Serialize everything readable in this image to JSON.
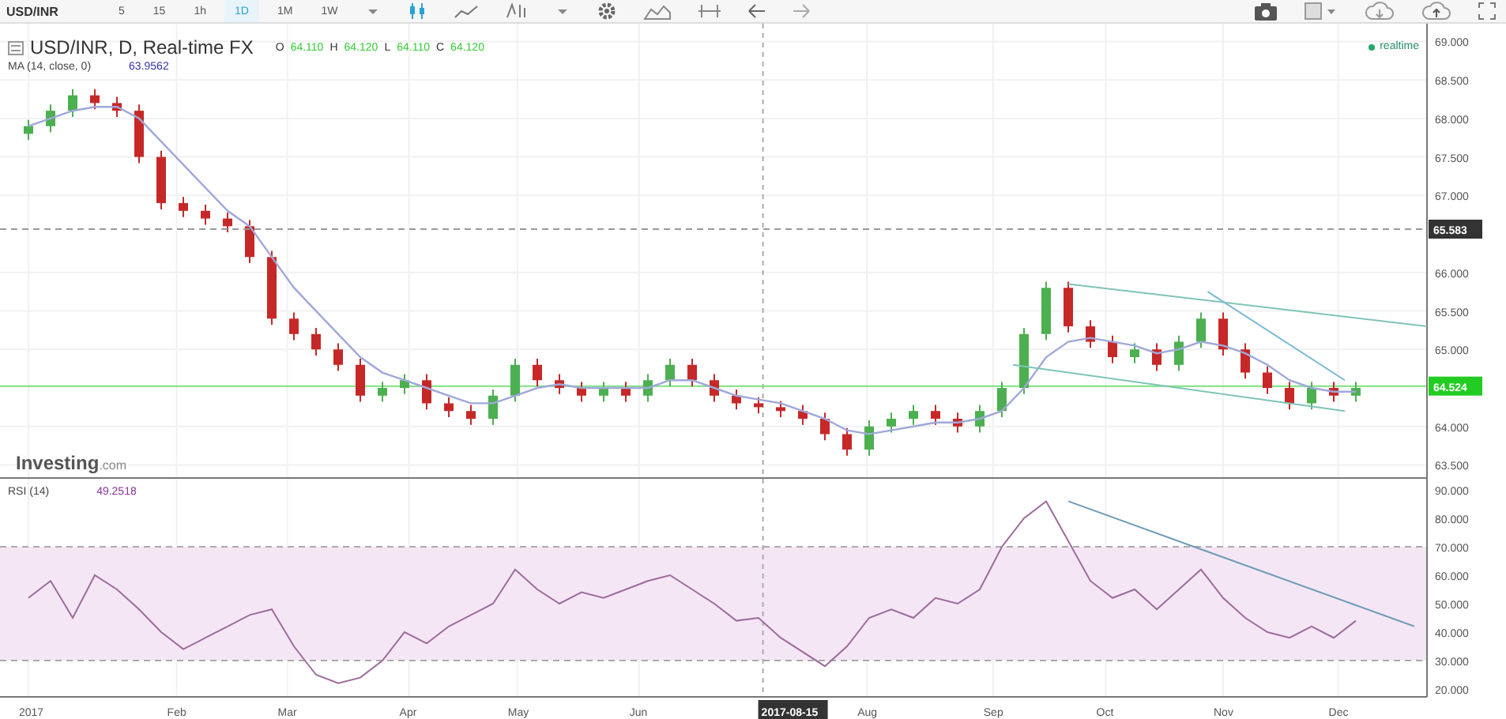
{
  "toolbar": {
    "intervals": [
      {
        "label": "5",
        "selected": false
      },
      {
        "label": "15",
        "selected": false
      },
      {
        "label": "1h",
        "selected": false
      },
      {
        "label": "1D",
        "selected": true
      },
      {
        "label": "1M",
        "selected": false
      },
      {
        "label": "1W",
        "selected": false
      }
    ]
  },
  "legend": {
    "title": "USD/INR, D, Real-time FX",
    "ohlc": [
      {
        "key": "O",
        "value": "64.110"
      },
      {
        "key": "H",
        "value": "64.120"
      },
      {
        "key": "L",
        "value": "64.110"
      },
      {
        "key": "C",
        "value": "64.120"
      }
    ],
    "ma_value": "63.9562",
    "status": "realtime"
  },
  "logo": {
    "name": "Investing",
    "suffix": ".com"
  },
  "price_chart": {
    "symbol": "USD/INR",
    "chart_data": {
      "type": "candlestick",
      "grid": true,
      "categories": [
        null,
        null,
        null,
        null,
        null,
        null,
        null,
        null,
        null,
        null,
        null,
        null,
        null,
        null,
        null,
        null,
        null,
        null,
        null,
        null,
        null,
        null,
        null,
        null,
        null,
        null,
        null,
        null,
        null,
        null,
        null,
        null,
        null,
        null,
        null,
        null,
        null,
        null,
        null,
        null,
        null,
        null,
        null,
        null,
        null,
        null,
        null,
        null,
        null,
        null,
        null,
        null,
        null,
        null,
        null,
        null,
        null,
        null,
        null,
        null,
        null
      ],
      "ylim": [
        63.32,
        69.23
      ],
      "yticks": [
        {
          "value": 69,
          "label": "69.000"
        },
        {
          "value": 68.5,
          "label": "68.500"
        },
        {
          "value": 68,
          "label": "68.000"
        },
        {
          "value": 67.5,
          "label": "67.500"
        },
        {
          "value": 67,
          "label": "67.000"
        },
        {
          "value": 66,
          "label": "66.000"
        },
        {
          "value": 65.5,
          "label": "65.500"
        },
        {
          "value": 65,
          "label": "65.000"
        },
        {
          "value": 64,
          "label": "64.000"
        },
        {
          "value": 63.5,
          "label": "63.500"
        }
      ],
      "ohlc": [
        [
          67.8,
          67.98,
          67.72,
          67.9
        ],
        [
          67.9,
          68.18,
          67.82,
          68.1
        ],
        [
          68.1,
          68.38,
          68.02,
          68.3
        ],
        [
          68.3,
          68.38,
          68.12,
          68.2
        ],
        [
          68.2,
          68.28,
          68.02,
          68.1
        ],
        [
          68.1,
          68.18,
          67.42,
          67.5
        ],
        [
          67.5,
          67.58,
          66.82,
          66.9
        ],
        [
          66.9,
          66.98,
          66.72,
          66.8
        ],
        [
          66.8,
          66.88,
          66.62,
          66.7
        ],
        [
          66.7,
          66.78,
          66.52,
          66.6
        ],
        [
          66.6,
          66.68,
          66.12,
          66.2
        ],
        [
          66.2,
          66.28,
          65.32,
          65.4
        ],
        [
          65.4,
          65.48,
          65.12,
          65.2
        ],
        [
          65.2,
          65.28,
          64.92,
          65.0
        ],
        [
          65.0,
          65.08,
          64.72,
          64.8
        ],
        [
          64.8,
          64.88,
          64.32,
          64.4
        ],
        [
          64.4,
          64.58,
          64.32,
          64.5
        ],
        [
          64.5,
          64.68,
          64.42,
          64.6
        ],
        [
          64.6,
          64.68,
          64.22,
          64.3
        ],
        [
          64.3,
          64.38,
          64.12,
          64.2
        ],
        [
          64.2,
          64.28,
          64.02,
          64.1
        ],
        [
          64.1,
          64.48,
          64.02,
          64.4
        ],
        [
          64.4,
          64.88,
          64.32,
          64.8
        ],
        [
          64.8,
          64.88,
          64.52,
          64.6
        ],
        [
          64.6,
          64.68,
          64.42,
          64.5
        ],
        [
          64.5,
          64.58,
          64.32,
          64.4
        ],
        [
          64.4,
          64.58,
          64.32,
          64.5
        ],
        [
          64.5,
          64.58,
          64.32,
          64.4
        ],
        [
          64.4,
          64.68,
          64.32,
          64.6
        ],
        [
          64.6,
          64.88,
          64.52,
          64.8
        ],
        [
          64.8,
          64.88,
          64.52,
          64.6
        ],
        [
          64.6,
          64.68,
          64.32,
          64.4
        ],
        [
          64.4,
          64.48,
          64.22,
          64.3
        ],
        [
          64.3,
          64.38,
          64.17,
          64.25
        ],
        [
          64.25,
          64.33,
          64.12,
          64.2
        ],
        [
          64.2,
          64.28,
          64.02,
          64.1
        ],
        [
          64.1,
          64.18,
          63.82,
          63.9
        ],
        [
          63.9,
          63.98,
          63.62,
          63.7
        ],
        [
          63.7,
          64.08,
          63.62,
          64.0
        ],
        [
          64.0,
          64.18,
          63.92,
          64.1
        ],
        [
          64.1,
          64.28,
          64.02,
          64.2
        ],
        [
          64.2,
          64.28,
          64.02,
          64.1
        ],
        [
          64.1,
          64.18,
          63.92,
          64.0
        ],
        [
          64.0,
          64.28,
          63.92,
          64.2
        ],
        [
          64.2,
          64.58,
          64.12,
          64.5
        ],
        [
          64.5,
          65.28,
          64.42,
          65.2
        ],
        [
          65.2,
          65.88,
          65.12,
          65.8
        ],
        [
          65.8,
          65.88,
          65.22,
          65.3
        ],
        [
          65.3,
          65.38,
          65.02,
          65.1
        ],
        [
          65.1,
          65.18,
          64.82,
          64.9
        ],
        [
          64.9,
          65.08,
          64.82,
          65.0
        ],
        [
          65.0,
          65.08,
          64.72,
          64.8
        ],
        [
          64.8,
          65.18,
          64.72,
          65.1
        ],
        [
          65.1,
          65.48,
          65.02,
          65.4
        ],
        [
          65.4,
          65.48,
          64.92,
          65.0
        ],
        [
          65.0,
          65.08,
          64.62,
          64.7
        ],
        [
          64.7,
          64.78,
          64.42,
          64.5
        ],
        [
          64.5,
          64.58,
          64.22,
          64.3
        ],
        [
          64.3,
          64.58,
          64.22,
          64.5
        ],
        [
          64.5,
          64.58,
          64.32,
          64.4
        ],
        [
          64.4,
          64.58,
          64.32,
          64.5
        ]
      ],
      "ref_lines": [
        {
          "axis": "y",
          "value": 64.524,
          "label": "64.524"
        }
      ],
      "series": [
        {
          "name": "MA (14, close, 0)",
          "type": "line",
          "color": "#9fa8da",
          "values": [
            67.9,
            68.0,
            68.1,
            68.15,
            68.15,
            68.0,
            67.7,
            67.4,
            67.1,
            66.8,
            66.6,
            66.2,
            65.8,
            65.5,
            65.2,
            64.9,
            64.7,
            64.6,
            64.5,
            64.4,
            64.3,
            64.3,
            64.4,
            64.5,
            64.55,
            64.5,
            64.5,
            64.5,
            64.5,
            64.6,
            64.6,
            64.5,
            64.4,
            64.35,
            64.3,
            64.2,
            64.1,
            63.95,
            63.9,
            63.95,
            64.0,
            64.05,
            64.05,
            64.1,
            64.2,
            64.5,
            64.9,
            65.1,
            65.15,
            65.1,
            65.05,
            64.95,
            65.0,
            65.1,
            65.05,
            64.95,
            64.8,
            64.6,
            64.5,
            64.45,
            64.45
          ]
        }
      ]
    }
  },
  "rsi_chart": {
    "value": "49.2518",
    "chart_data": {
      "type": "line",
      "grid": true,
      "categories": [
        null,
        null,
        null,
        null,
        null,
        null,
        null,
        null,
        null,
        null,
        null,
        null,
        null,
        null,
        null,
        null,
        null,
        null,
        null,
        null,
        null,
        null,
        null,
        null,
        null,
        null,
        null,
        null,
        null,
        null,
        null,
        null,
        null,
        null,
        null,
        null,
        null,
        null,
        null,
        null,
        null,
        null,
        null,
        null,
        null,
        null,
        null,
        null,
        null,
        null,
        null,
        null,
        null,
        null,
        null,
        null,
        null,
        null,
        null,
        null,
        null
      ],
      "ylim": [
        17.2,
        93.9
      ],
      "yticks": [
        {
          "value": 90,
          "label": "90.000"
        },
        {
          "value": 80,
          "label": "80.000"
        },
        {
          "value": 70,
          "label": "70.000"
        },
        {
          "value": 60,
          "label": "60.000"
        },
        {
          "value": 50,
          "label": "50.000"
        },
        {
          "value": 40,
          "label": "40.000"
        },
        {
          "value": 30,
          "label": "30.000"
        },
        {
          "value": 20,
          "label": "20.000"
        }
      ],
      "series": [
        {
          "name": "RSI (14)",
          "color": "#9c6b9c",
          "values": [
            52,
            58,
            45,
            60,
            55,
            48,
            40,
            34,
            38,
            42,
            46,
            48,
            35,
            25,
            22,
            24,
            30,
            40,
            36,
            42,
            46,
            50,
            62,
            55,
            50,
            54,
            52,
            55,
            58,
            60,
            55,
            50,
            44,
            45,
            38,
            33,
            28,
            35,
            45,
            48,
            45,
            52,
            50,
            55,
            70,
            80,
            86,
            72,
            58,
            52,
            55,
            48,
            55,
            62,
            52,
            45,
            40,
            38,
            42,
            38,
            44
          ]
        }
      ]
    }
  },
  "months": [
    "2017",
    "Feb",
    "Mar",
    "Apr",
    "May",
    "Jun",
    "Aug",
    "Sep",
    "Oct",
    "Nov",
    "Dec"
  ],
  "crosshair": {
    "label": "2017-08-15",
    "price": "65.583"
  }
}
